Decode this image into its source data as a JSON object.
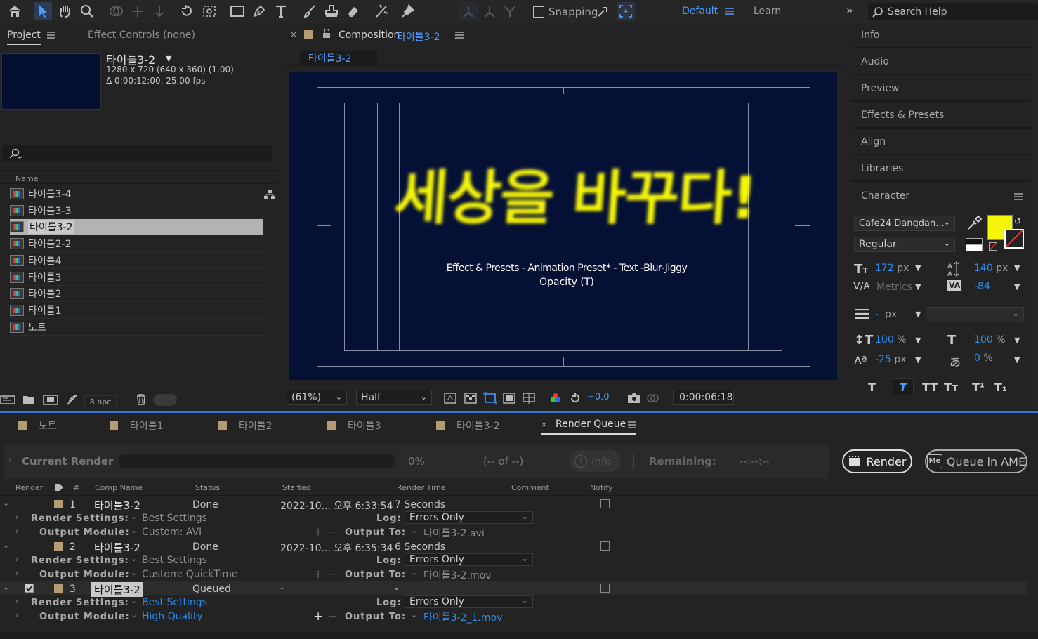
{
  "toolbar": {
    "snapping": "Snapping",
    "workspace_default": "Default",
    "workspace_learn": "Learn",
    "search_help": "Search Help"
  },
  "project": {
    "tab_project": "Project",
    "tab_effect_controls": "Effect Controls (none)",
    "comp_name": "타이틀3-2",
    "comp_res": "1280 x 720  (640 x 360) (1.00)",
    "comp_dur": "Δ 0:00:12:00, 25.00 fps",
    "col_name": "Name",
    "items": [
      "타이틀3-4",
      "타이틀3-3",
      "타이틀3-2",
      "타이틀2-2",
      "타이틀4",
      "타이틀3",
      "타이틀2",
      "타이틀1",
      "노트"
    ],
    "selected_index": 2,
    "bpc": "8 bpc"
  },
  "composition": {
    "tab_label": "Composition",
    "tab_name": "타이틀3-2",
    "breadcrumb": "타이틀3-2",
    "headline": "세상을 바꾸다!",
    "line1": "Effect & Presets - Animation Preset* - Text -Blur-Jiggy",
    "line2": "Opacity (T)",
    "zoom": "(61%)",
    "resolution": "Half",
    "exposure": "+0.0",
    "timecode": "0:00:06:18"
  },
  "right_panels": {
    "info": "Info",
    "audio": "Audio",
    "preview": "Preview",
    "effects_presets": "Effects & Presets",
    "align": "Align",
    "libraries": "Libraries",
    "character": "Character"
  },
  "character": {
    "font": "Cafe24 Dangdan...",
    "style": "Regular",
    "size_val": "172",
    "size_unit": "px",
    "leading_val": "140",
    "leading_unit": "px",
    "kerning": "Metrics",
    "tracking": "-84",
    "stroke_val": "-",
    "stroke_unit": "px",
    "vscale": "100",
    "vscale_unit": "%",
    "hscale": "100",
    "hscale_unit": "%",
    "baseline": "-25",
    "baseline_unit": "px",
    "tsume": "0",
    "tsume_unit": "%",
    "fill_color": "#f5f50a",
    "styles": [
      "T",
      "T",
      "TT",
      "Tт",
      "T¹",
      "T₁"
    ]
  },
  "bottom_tabs": [
    "노트",
    "타이틀1",
    "타이틀2",
    "타이틀3",
    "타이틀3-2"
  ],
  "render_queue": {
    "tab": "Render Queue",
    "current_render": "Current Render",
    "percent": "0%",
    "of": "(-- of --)",
    "info": "Info",
    "remaining": "Remaining:",
    "remaining_val": "--:--:--",
    "render_btn": "Render",
    "queue_ame": "Queue in AME",
    "headers": {
      "render": "Render",
      "num": "#",
      "comp": "Comp Name",
      "status": "Status",
      "started": "Started",
      "render_time": "Render Time",
      "comment": "Comment",
      "notify": "Notify"
    },
    "labels": {
      "render_settings": "Render Settings:",
      "output_module": "Output Module:",
      "log": "Log:",
      "output_to": "Output To:"
    },
    "items": [
      {
        "num": "1",
        "comp": "타이틀3-2",
        "status": "Done",
        "started": "2022-10... 오후 6:33:54",
        "time": "7 Seconds",
        "rs": "Best Settings",
        "om": "Custom: AVI",
        "log": "Errors Only",
        "out": "타이틀3-2.avi"
      },
      {
        "num": "2",
        "comp": "타이틀3-2",
        "status": "Done",
        "started": "2022-10... 오후 6:35:34",
        "time": "6 Seconds",
        "rs": "Best Settings",
        "om": "Custom: QuickTime",
        "log": "Errors Only",
        "out": "타이틀3-2.mov"
      },
      {
        "num": "3",
        "comp": "타이틀3-2",
        "status": "Queued",
        "started": "-",
        "time": "-",
        "rs": "Best Settings",
        "om": "High Quality",
        "log": "Errors Only",
        "out": "타이틀3-2_1.mov"
      }
    ]
  }
}
